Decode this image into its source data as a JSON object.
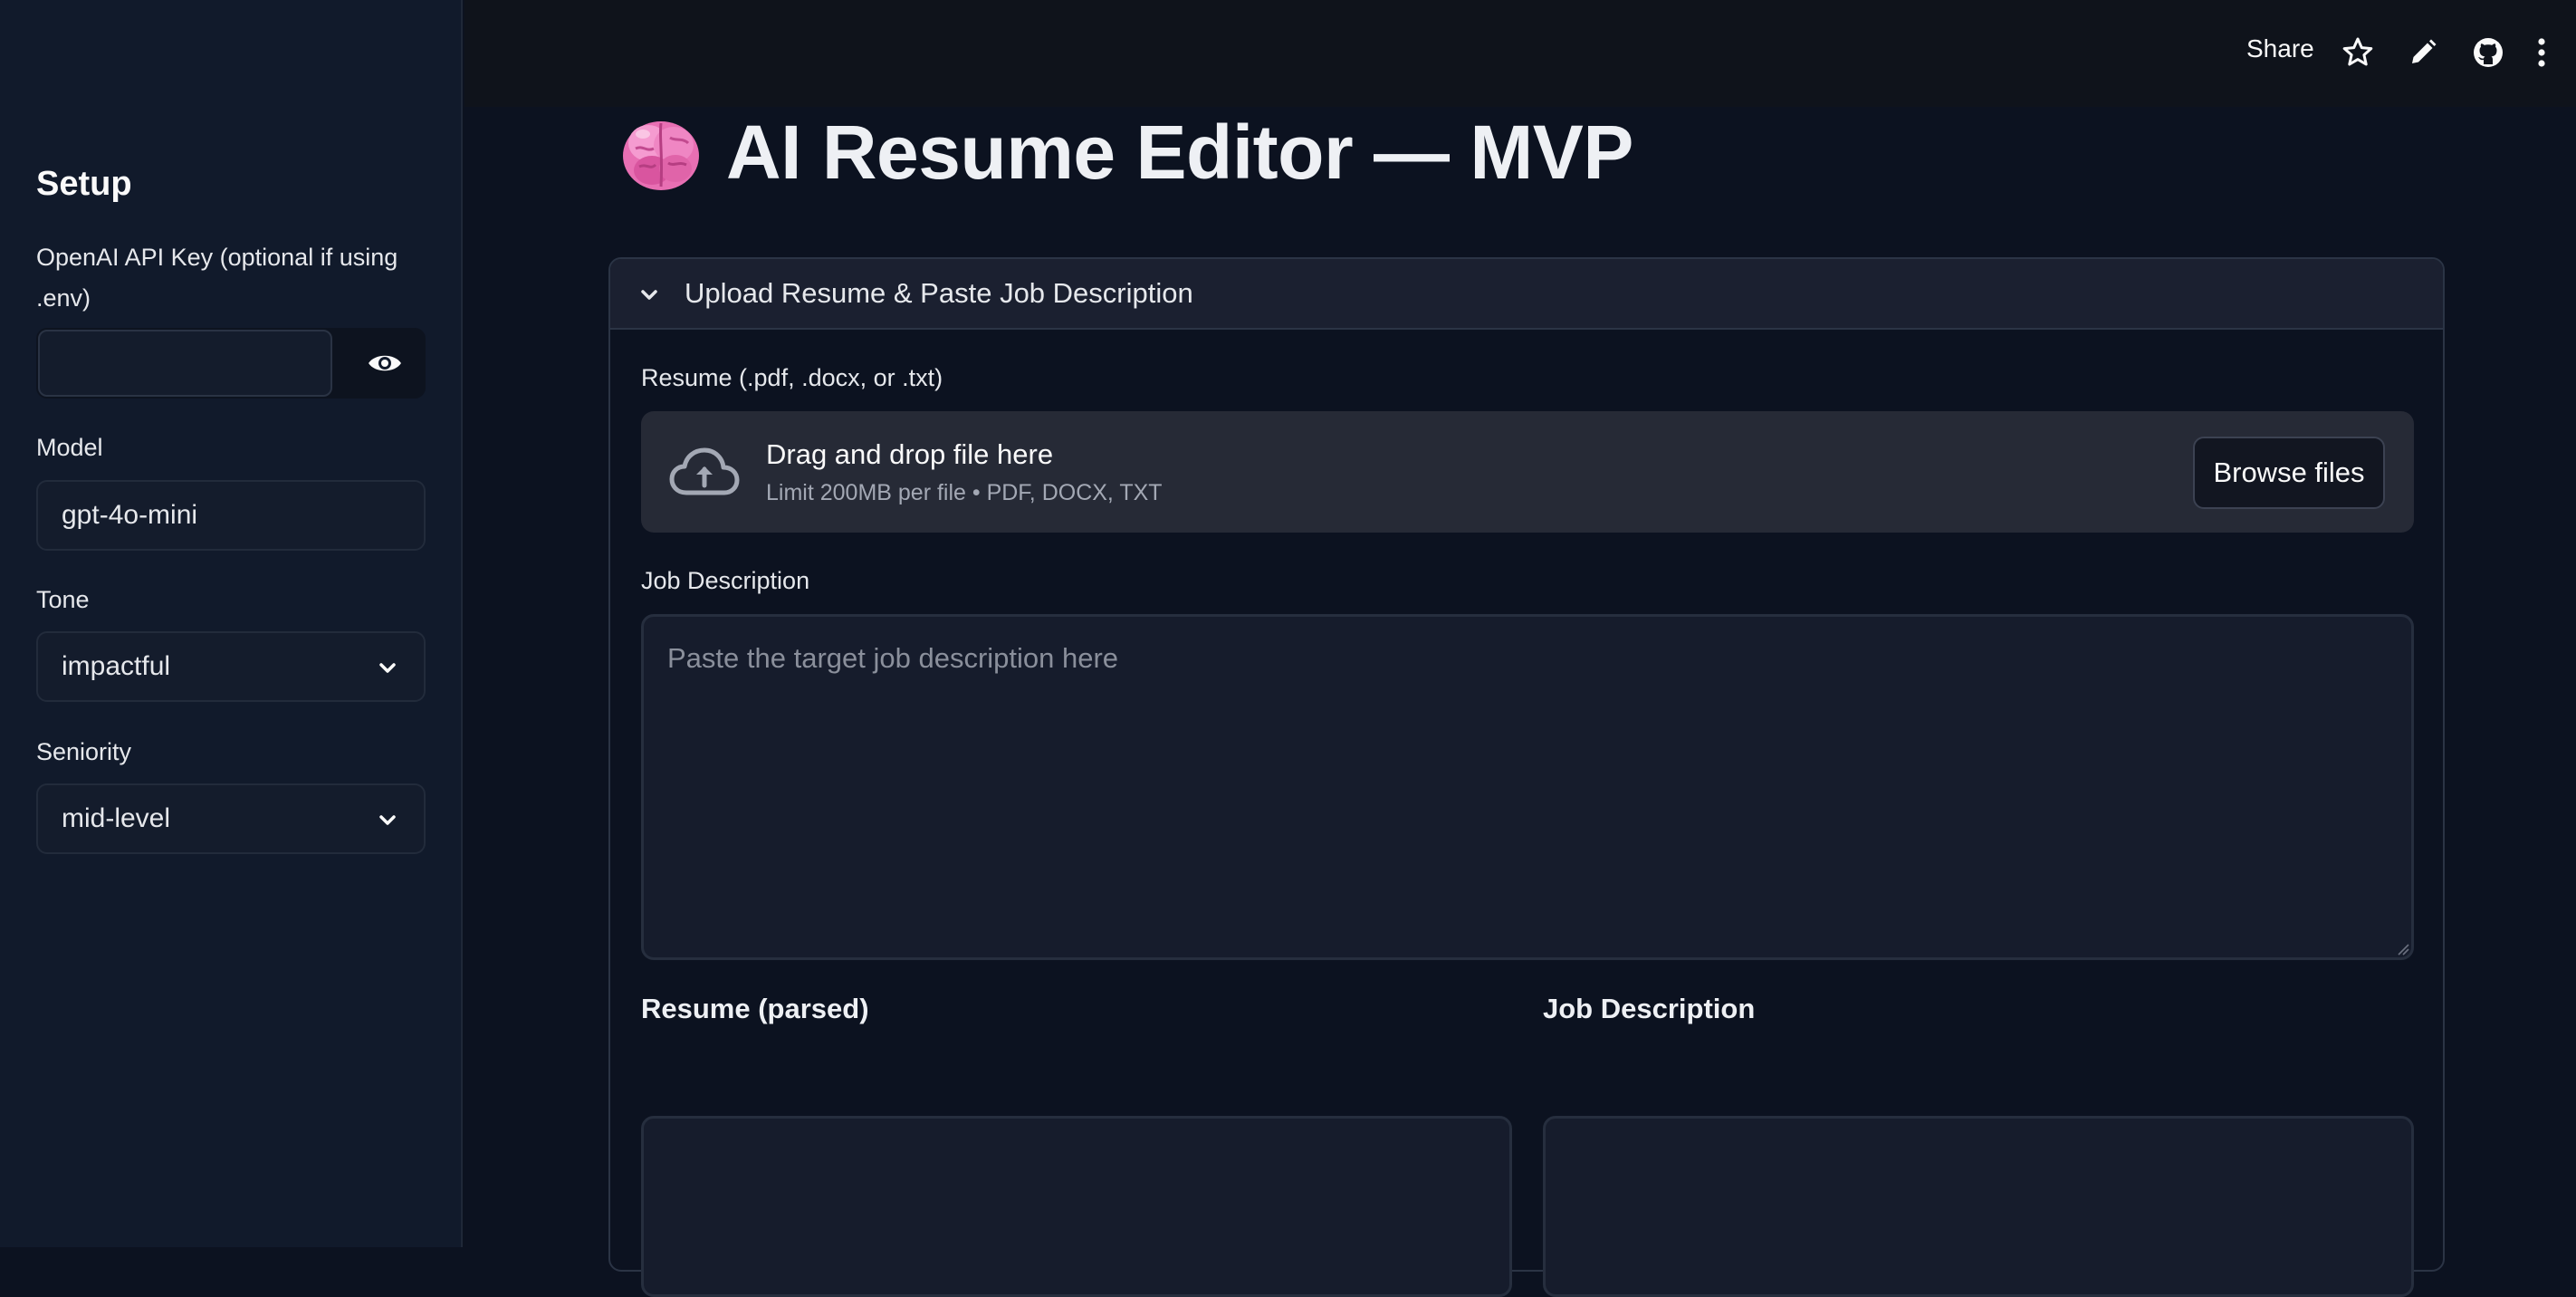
{
  "sidebar": {
    "title": "Setup",
    "api_key_label_line1": "OpenAI API Key (optional if using",
    "api_key_label_line2": ".env)",
    "api_key_value": "",
    "model_label": "Model",
    "model_value": "gpt-4o-mini",
    "tone_label": "Tone",
    "tone_value": "impactful",
    "seniority_label": "Seniority",
    "seniority_value": "mid-level"
  },
  "header": {
    "share_label": "Share",
    "icons": [
      "star-icon",
      "pencil-icon",
      "github-icon",
      "more-vertical-icon"
    ]
  },
  "main": {
    "title_emoji": "brain-emoji",
    "title": "AI Resume Editor — MVP",
    "expander": {
      "label": "Upload Resume & Paste Job Description",
      "resume_label": "Resume (.pdf, .docx, or .txt)",
      "dropzone_main": "Drag and drop file here",
      "dropzone_sub": "Limit 200MB per file • PDF, DOCX, TXT",
      "browse_label": "Browse files",
      "jd_label": "Job Description",
      "jd_placeholder": "Paste the target job description here",
      "resume_parsed_heading": "Resume (parsed)",
      "jd_heading": "Job Description"
    }
  },
  "colors": {
    "background": "#0c1220",
    "sidebar": "#111a2b",
    "header": "#0f131b",
    "text": "#fafafa",
    "muted": "#8a8f9b"
  }
}
